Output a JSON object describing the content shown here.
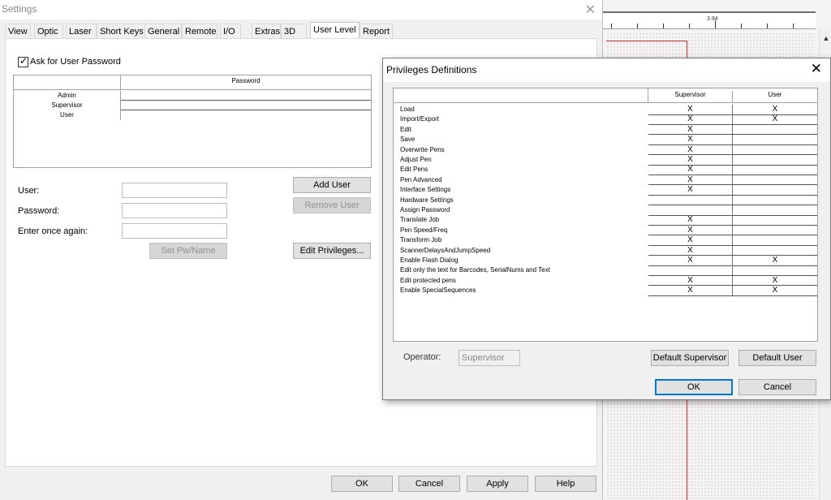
{
  "background": {
    "ruler_label": "3.94"
  },
  "settings": {
    "title": "Settings",
    "tabs": [
      "View",
      "Optic",
      "Laser",
      "Short Keys",
      "General",
      "Remote",
      "I/O",
      "Extras",
      "3D",
      "User Level",
      "Report"
    ],
    "active_tab": "User Level",
    "ask_password_label": "Ask for User Password",
    "ask_password_checked": true,
    "users_table": {
      "header_password": "Password",
      "users": [
        "Admin",
        "Supervisor",
        "User"
      ]
    },
    "form": {
      "user_label": "User:",
      "password_label": "Password:",
      "confirm_label": "Enter once again:",
      "user_value": "",
      "password_value": "",
      "confirm_value": ""
    },
    "buttons": {
      "add_user": "Add User",
      "remove_user": "Remove User",
      "set_pw_name": "Set Pw/Name",
      "edit_privileges": "Edit Privileges...",
      "ok": "OK",
      "cancel": "Cancel",
      "apply": "Apply",
      "help": "Help"
    }
  },
  "privileges": {
    "title": "Privileges Definitions",
    "columns": [
      "Supervisor",
      "User"
    ],
    "rows": [
      {
        "label": "Load",
        "supervisor": "X",
        "user": "X"
      },
      {
        "label": "Import/Export",
        "supervisor": "X",
        "user": "X"
      },
      {
        "label": "Edit",
        "supervisor": "X",
        "user": ""
      },
      {
        "label": "Save",
        "supervisor": "X",
        "user": ""
      },
      {
        "label": "Overwrite Pens",
        "supervisor": "X",
        "user": ""
      },
      {
        "label": "Adjust Pen",
        "supervisor": "X",
        "user": ""
      },
      {
        "label": "Edit Pens",
        "supervisor": "X",
        "user": ""
      },
      {
        "label": "Pen Advanced",
        "supervisor": "X",
        "user": ""
      },
      {
        "label": "Interface Settings",
        "supervisor": "X",
        "user": ""
      },
      {
        "label": "Hardware Settings",
        "supervisor": "",
        "user": ""
      },
      {
        "label": "Assign Password",
        "supervisor": "",
        "user": ""
      },
      {
        "label": "Translate Job",
        "supervisor": "X",
        "user": ""
      },
      {
        "label": "Pen Speed/Freq",
        "supervisor": "X",
        "user": ""
      },
      {
        "label": "Transform Job",
        "supervisor": "X",
        "user": ""
      },
      {
        "label": "ScannerDelaysAndJumpSpeed",
        "supervisor": "X",
        "user": ""
      },
      {
        "label": "Enable Flash Dialog",
        "supervisor": "X",
        "user": "X"
      },
      {
        "label": "Edit only the text for Barcodes, SerialNums and Text",
        "supervisor": "",
        "user": ""
      },
      {
        "label": "Edit protected pens",
        "supervisor": "X",
        "user": "X"
      },
      {
        "label": "Enable SpecialSequences",
        "supervisor": "X",
        "user": "X"
      }
    ],
    "operator_label": "Operator:",
    "operator_value": "Supervisor",
    "buttons": {
      "default_supervisor": "Default Supervisor",
      "default_user": "Default User",
      "ok": "OK",
      "cancel": "Cancel"
    }
  }
}
